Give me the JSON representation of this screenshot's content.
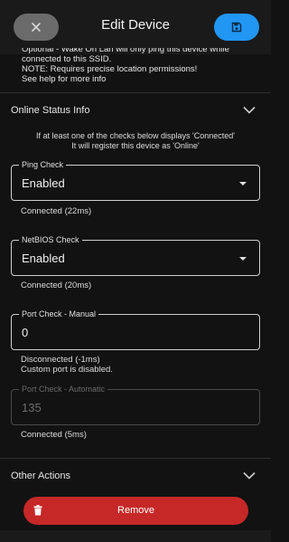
{
  "header": {
    "title": "Edit Device",
    "close_icon": "close-icon",
    "save_icon": "save-icon",
    "close_color": "#6b6b6b",
    "save_color": "#2196f3"
  },
  "wake_on_lan_note": {
    "line1": "Optional - Wake On Lan will only ping this device while",
    "line2": "connected to this SSID.",
    "line3": "NOTE: Requires precise location permissions!",
    "line4": "See help for more info"
  },
  "online_status": {
    "title": "Online Status Info",
    "info_line1": "If at least one of the checks below displays 'Connected'",
    "info_line2": "It will register this device as 'Online'",
    "ping_check": {
      "label": "Ping Check",
      "value": "Enabled",
      "status": "Connected (22ms)"
    },
    "netbios_check": {
      "label": "NetBIOS Check",
      "value": "Enabled",
      "status": "Connected (20ms)"
    },
    "port_manual": {
      "label": "Port Check - Manual",
      "value": "0",
      "status_line1": "Disconnected (-1ms)",
      "status_line2": "Custom port is disabled."
    },
    "port_automatic": {
      "label": "Port Check - Automatic",
      "value": "135",
      "status": "Connected (5ms)"
    }
  },
  "other_actions": {
    "title": "Other Actions",
    "remove_label": "Remove",
    "remove_color": "#c62828"
  }
}
